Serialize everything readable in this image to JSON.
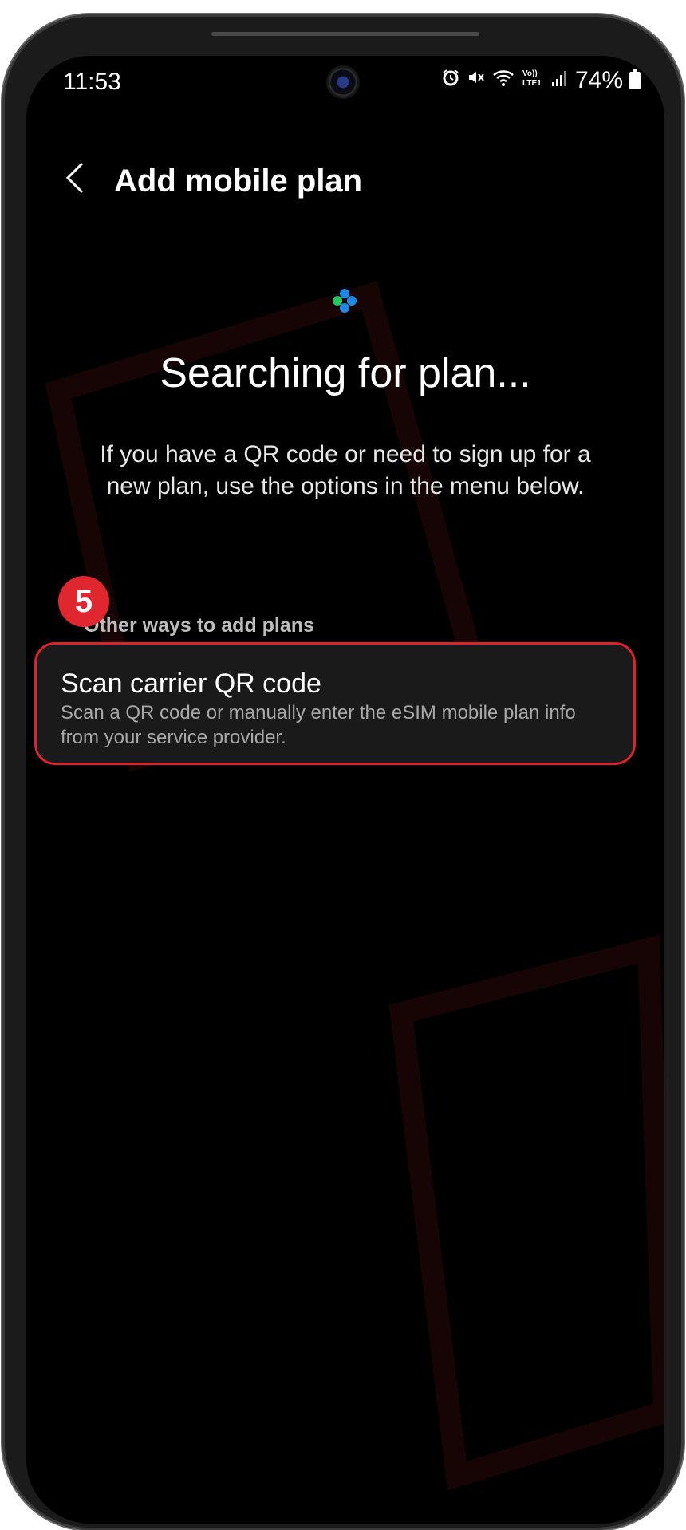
{
  "status_bar": {
    "time": "11:53",
    "icons": [
      "alarm-icon",
      "mute-icon",
      "wifi-icon",
      "volte-icon",
      "signal-icon"
    ],
    "volte_label": "Vo))\nLTE1",
    "battery_percent": "74%"
  },
  "header": {
    "back_icon": "chevron-left-icon",
    "title": "Add mobile plan"
  },
  "main": {
    "heading": "Searching for plan...",
    "description": "If you have a QR code or need to sign up for a new plan, use the options in the menu below."
  },
  "step_badge": "5",
  "section": {
    "label": "Other ways to add plans",
    "items": [
      {
        "title": "Scan carrier QR code",
        "subtitle": "Scan a QR code or manually enter the eSIM mobile plan info from your service provider."
      }
    ]
  },
  "colors": {
    "accent_red": "#e0262e",
    "screen_bg": "#000000",
    "spinner_blue": "#1e88e5",
    "spinner_green": "#22c55e"
  }
}
